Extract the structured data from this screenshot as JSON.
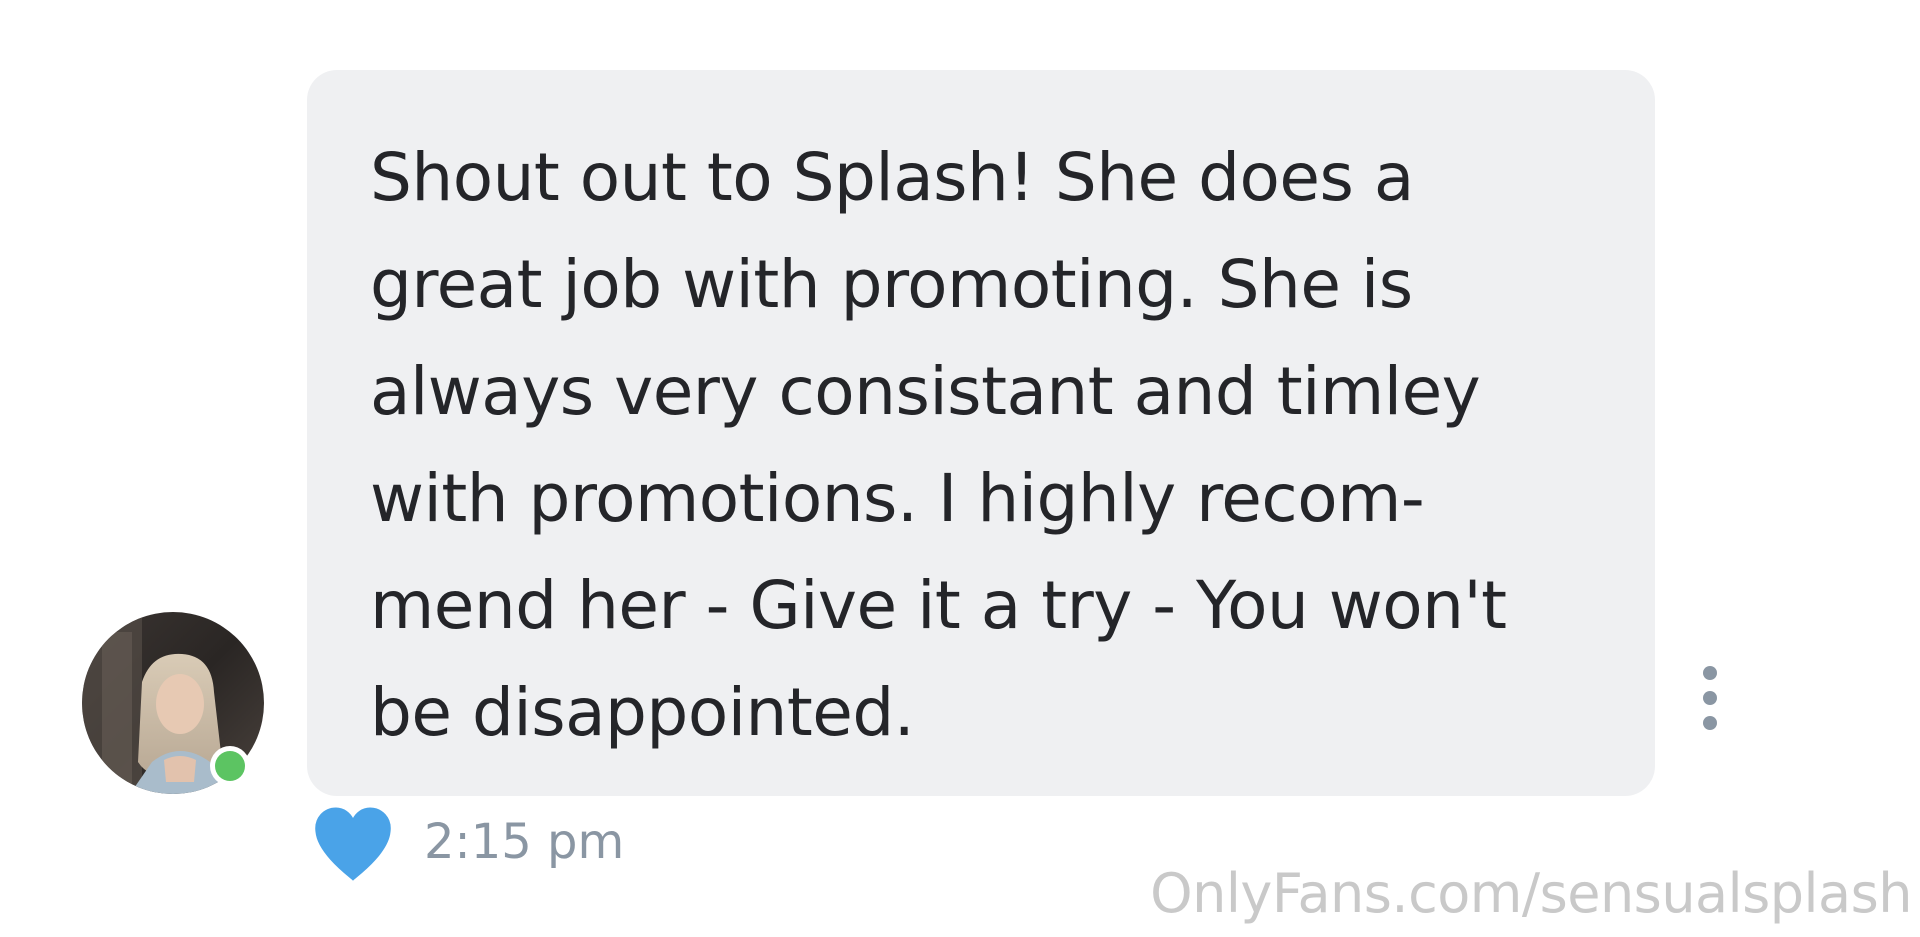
{
  "message": {
    "lines": [
      "Shout out to Splash! She does a",
      "great job with promoting. She is",
      "always very consistant and timley",
      "with promotions. I highly recom-",
      "mend her - Give it a try - You won't",
      "be disappointed."
    ],
    "time": "2:15 pm",
    "liked": true
  },
  "sender": {
    "avatar_icon": "user-photo",
    "online": true
  },
  "watermark": "OnlyFans.com/sensualsplash",
  "colors": {
    "bubble": "#eff0f2",
    "text": "#242529",
    "heart": "#4aa3e8",
    "online": "#5cc462",
    "timestamp": "#8a96a3",
    "more_dots": "#8a96a3",
    "watermark": "#c9c9c9"
  }
}
